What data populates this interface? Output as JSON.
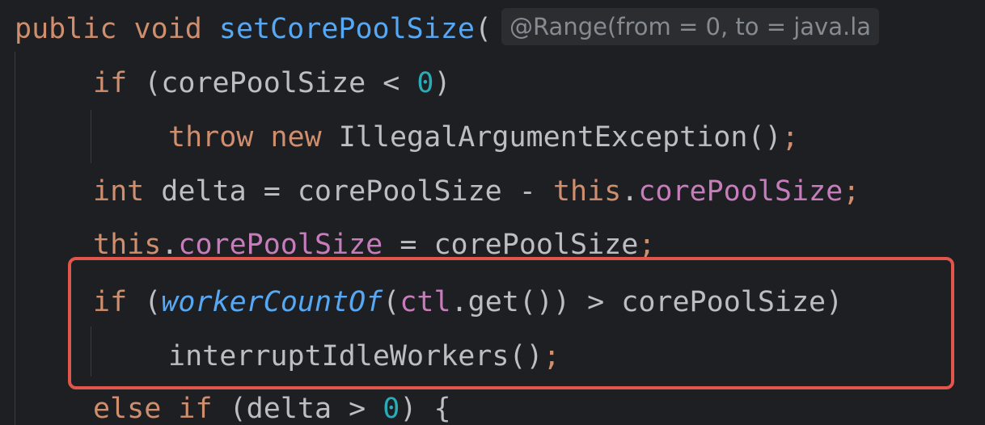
{
  "editor": {
    "lines": [
      {
        "tokens": {
          "kw1": "public",
          "kw2": "void",
          "fn": "setCorePoolSize",
          "paren": "(",
          "hint": "@Range(from = 0, to = java.la"
        }
      },
      {
        "tokens": {
          "kw": "if",
          "rest1": " (corePoolSize < ",
          "num": "0",
          "rest2": ")"
        }
      },
      {
        "tokens": {
          "kw1": "throw",
          "kw2": "new",
          "rest": " IllegalArgumentException()",
          "semi": ";"
        }
      },
      {
        "tokens": {
          "kw": "int",
          "rest1": " delta = corePoolSize - ",
          "kw2": "this",
          "dot": ".",
          "field": "corePoolSize",
          "semi": ";"
        }
      },
      {
        "tokens": {
          "kw": "this",
          "dot": ".",
          "field": "corePoolSize",
          "rest": " = corePoolSize",
          "semi": ";"
        }
      },
      {
        "tokens": {
          "kw": "if",
          "open": " (",
          "call": "workerCountOf",
          "p1": "(",
          "field": "ctl",
          "rest": ".get()) > corePoolSize)"
        }
      },
      {
        "tokens": {
          "rest": "interruptIdleWorkers()",
          "semi": ";"
        }
      },
      {
        "tokens": {
          "kw1": "else",
          "kw2": "if",
          "rest1": " (delta > ",
          "num": "0",
          "rest2": ") {"
        }
      }
    ]
  },
  "highlight": {
    "color": "#e0564b"
  },
  "colors": {
    "background": "#1e1f22",
    "keyword": "#cf8e6d",
    "method_declaration": "#56a8f5",
    "number": "#2aacb8",
    "field": "#c77dbb",
    "text": "#bcbec4",
    "inlay_hint": "#868a91"
  }
}
